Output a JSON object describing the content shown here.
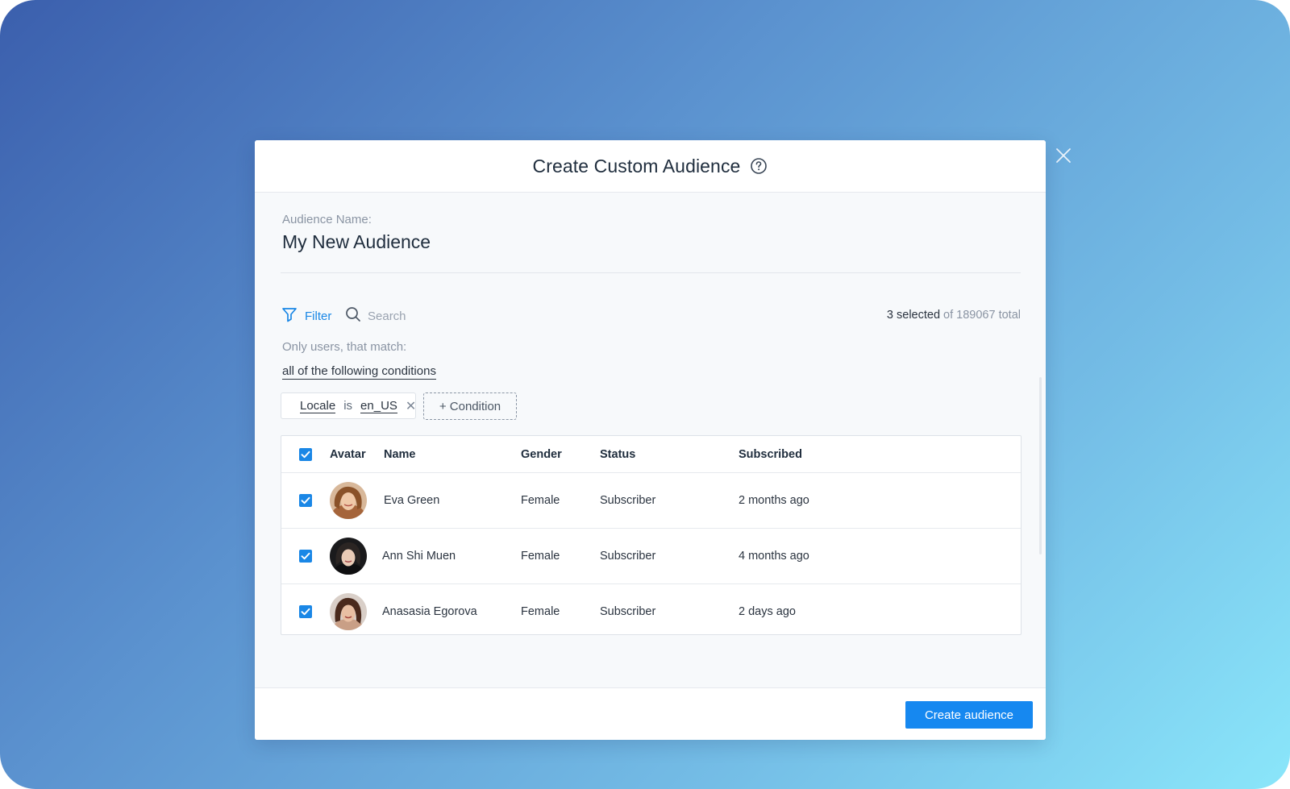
{
  "modal": {
    "title": "Create Custom Audience",
    "audience_name_label": "Audience Name:",
    "audience_name_value": "My New Audience"
  },
  "toolbar": {
    "filter_label": "Filter",
    "search_placeholder": "Search",
    "selected_text": "3 selected",
    "total_text": "of 189067 total"
  },
  "conditions": {
    "match_label": "Only users, that match:",
    "match_mode": "all of the following conditions",
    "chip": {
      "field": "Locale",
      "operator": "is",
      "value": "en_US"
    },
    "add_label": "+ Condition"
  },
  "table": {
    "columns": [
      "Avatar",
      "Name",
      "Gender",
      "Status",
      "Subscribed"
    ],
    "rows": [
      {
        "name": "Eva Green",
        "gender": "Female",
        "status": "Subscriber",
        "subscribed": "2 months ago"
      },
      {
        "name": "Ann Shi Muen",
        "gender": "Female",
        "status": "Subscriber",
        "subscribed": "4 months ago"
      },
      {
        "name": "Anasasia Egorova",
        "gender": "Female",
        "status": "Subscriber",
        "subscribed": "2 days ago"
      }
    ]
  },
  "footer": {
    "create_label": "Create audience"
  },
  "colors": {
    "accent": "#1688f0",
    "link": "#1a87e6",
    "background_gradient_start": "#3b5fad",
    "background_gradient_end": "#8ae6fa"
  },
  "icons": [
    "close-icon",
    "help-icon",
    "filter-icon",
    "search-icon",
    "checkbox-checked-icon",
    "remove-icon"
  ]
}
